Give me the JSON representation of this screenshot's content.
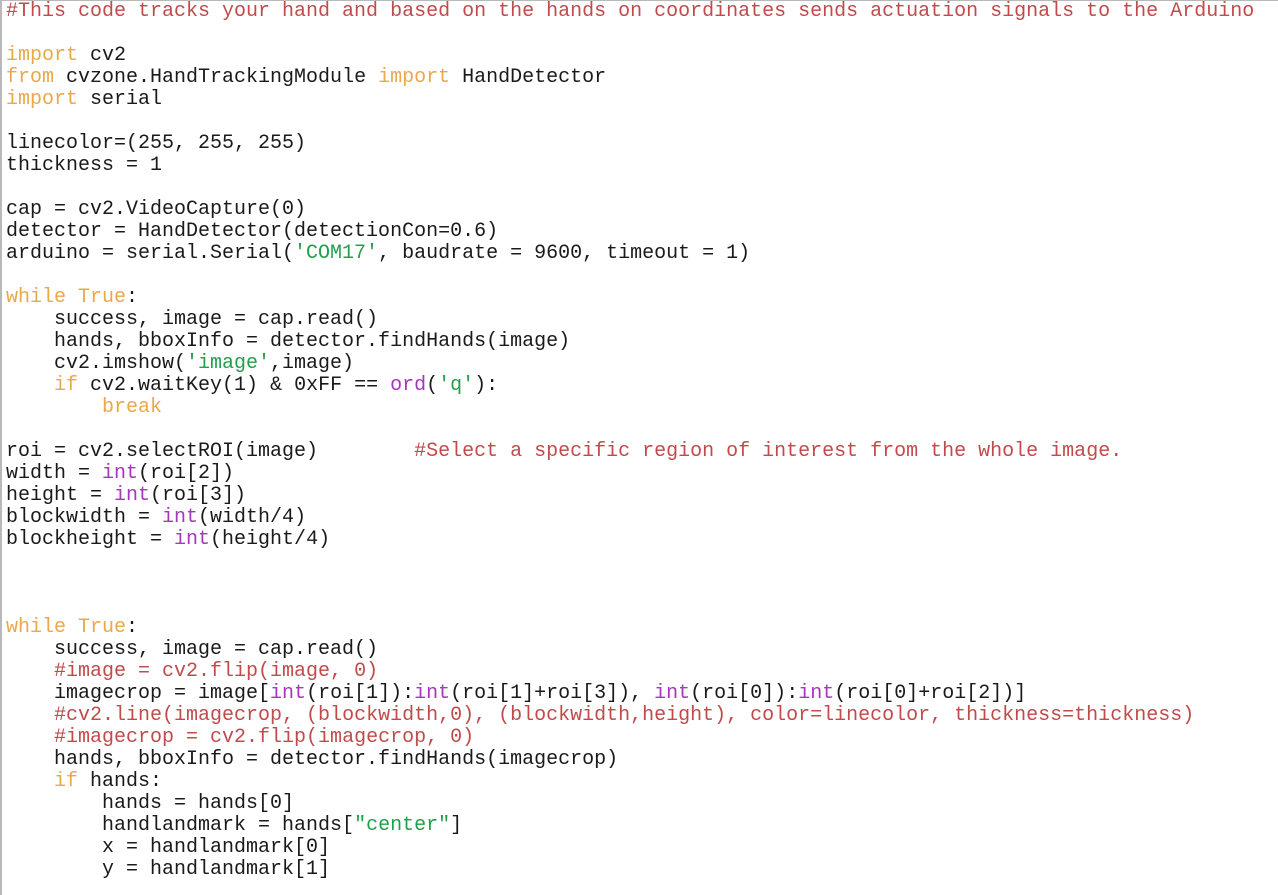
{
  "document": {
    "kind": "python-source-code",
    "language": "Python",
    "background_color": "#ffffff",
    "default_text_color": "#1a1a1a"
  },
  "syntax_colors": {
    "comment": "#c14b4b",
    "keyword": "#e9a84a",
    "string": "#21a04a",
    "builtin": "#a736bf",
    "plain": "#1a1a1a"
  },
  "code": {
    "lines": [
      [
        {
          "t": "comment",
          "s": "#This code tracks your hand and based on the hands on coordinates sends actuation signals to the Arduino"
        }
      ],
      [
        {
          "t": "plain",
          "s": ""
        }
      ],
      [
        {
          "t": "keyword",
          "s": "import"
        },
        {
          "t": "plain",
          "s": " cv2"
        }
      ],
      [
        {
          "t": "keyword",
          "s": "from"
        },
        {
          "t": "plain",
          "s": " cvzone.HandTrackingModule "
        },
        {
          "t": "keyword",
          "s": "import"
        },
        {
          "t": "plain",
          "s": " HandDetector"
        }
      ],
      [
        {
          "t": "keyword",
          "s": "import"
        },
        {
          "t": "plain",
          "s": " serial"
        }
      ],
      [
        {
          "t": "plain",
          "s": ""
        }
      ],
      [
        {
          "t": "plain",
          "s": "linecolor=(255, 255, 255)"
        }
      ],
      [
        {
          "t": "plain",
          "s": "thickness = 1"
        }
      ],
      [
        {
          "t": "plain",
          "s": ""
        }
      ],
      [
        {
          "t": "plain",
          "s": "cap = cv2.VideoCapture(0)"
        }
      ],
      [
        {
          "t": "plain",
          "s": "detector = HandDetector(detectionCon=0.6)"
        }
      ],
      [
        {
          "t": "plain",
          "s": "arduino = serial.Serial("
        },
        {
          "t": "string",
          "s": "'COM17'"
        },
        {
          "t": "plain",
          "s": ", baudrate = 9600, timeout = 1)"
        }
      ],
      [
        {
          "t": "plain",
          "s": ""
        }
      ],
      [
        {
          "t": "keyword",
          "s": "while True"
        },
        {
          "t": "plain",
          "s": ":"
        }
      ],
      [
        {
          "t": "plain",
          "s": "    success, image = cap.read()"
        }
      ],
      [
        {
          "t": "plain",
          "s": "    hands, bboxInfo = detector.findHands(image)"
        }
      ],
      [
        {
          "t": "plain",
          "s": "    cv2.imshow("
        },
        {
          "t": "string",
          "s": "'image'"
        },
        {
          "t": "plain",
          "s": ",image)"
        }
      ],
      [
        {
          "t": "plain",
          "s": "    "
        },
        {
          "t": "keyword",
          "s": "if"
        },
        {
          "t": "plain",
          "s": " cv2.waitKey(1) & 0xFF == "
        },
        {
          "t": "builtin",
          "s": "ord"
        },
        {
          "t": "plain",
          "s": "("
        },
        {
          "t": "string",
          "s": "'q'"
        },
        {
          "t": "plain",
          "s": "):"
        }
      ],
      [
        {
          "t": "plain",
          "s": "        "
        },
        {
          "t": "keyword",
          "s": "break"
        }
      ],
      [
        {
          "t": "plain",
          "s": ""
        }
      ],
      [
        {
          "t": "plain",
          "s": "roi = cv2.selectROI(image)        "
        },
        {
          "t": "comment",
          "s": "#Select a specific region of interest from the whole image."
        }
      ],
      [
        {
          "t": "plain",
          "s": "width = "
        },
        {
          "t": "builtin",
          "s": "int"
        },
        {
          "t": "plain",
          "s": "(roi[2])"
        }
      ],
      [
        {
          "t": "plain",
          "s": "height = "
        },
        {
          "t": "builtin",
          "s": "int"
        },
        {
          "t": "plain",
          "s": "(roi[3])"
        }
      ],
      [
        {
          "t": "plain",
          "s": "blockwidth = "
        },
        {
          "t": "builtin",
          "s": "int"
        },
        {
          "t": "plain",
          "s": "(width/4)"
        }
      ],
      [
        {
          "t": "plain",
          "s": "blockheight = "
        },
        {
          "t": "builtin",
          "s": "int"
        },
        {
          "t": "plain",
          "s": "(height/4)"
        }
      ],
      [
        {
          "t": "plain",
          "s": ""
        }
      ],
      [
        {
          "t": "plain",
          "s": ""
        }
      ],
      [
        {
          "t": "plain",
          "s": ""
        }
      ],
      [
        {
          "t": "keyword",
          "s": "while True"
        },
        {
          "t": "plain",
          "s": ":"
        }
      ],
      [
        {
          "t": "plain",
          "s": "    success, image = cap.read()"
        }
      ],
      [
        {
          "t": "plain",
          "s": "    "
        },
        {
          "t": "comment",
          "s": "#image = cv2.flip(image, 0)"
        }
      ],
      [
        {
          "t": "plain",
          "s": "    imagecrop = image["
        },
        {
          "t": "builtin",
          "s": "int"
        },
        {
          "t": "plain",
          "s": "(roi[1]):"
        },
        {
          "t": "builtin",
          "s": "int"
        },
        {
          "t": "plain",
          "s": "(roi[1]+roi[3]), "
        },
        {
          "t": "builtin",
          "s": "int"
        },
        {
          "t": "plain",
          "s": "(roi[0]):"
        },
        {
          "t": "builtin",
          "s": "int"
        },
        {
          "t": "plain",
          "s": "(roi[0]+roi[2])]"
        }
      ],
      [
        {
          "t": "plain",
          "s": "    "
        },
        {
          "t": "comment",
          "s": "#cv2.line(imagecrop, (blockwidth,0), (blockwidth,height), color=linecolor, thickness=thickness)"
        }
      ],
      [
        {
          "t": "plain",
          "s": "    "
        },
        {
          "t": "comment",
          "s": "#imagecrop = cv2.flip(imagecrop, 0)"
        }
      ],
      [
        {
          "t": "plain",
          "s": "    hands, bboxInfo = detector.findHands(imagecrop)"
        }
      ],
      [
        {
          "t": "plain",
          "s": "    "
        },
        {
          "t": "keyword",
          "s": "if"
        },
        {
          "t": "plain",
          "s": " hands:"
        }
      ],
      [
        {
          "t": "plain",
          "s": "        hands = hands[0]"
        }
      ],
      [
        {
          "t": "plain",
          "s": "        handlandmark = hands["
        },
        {
          "t": "string",
          "s": "\"center\""
        },
        {
          "t": "plain",
          "s": "]"
        }
      ],
      [
        {
          "t": "plain",
          "s": "        x = handlandmark[0]"
        }
      ],
      [
        {
          "t": "plain",
          "s": "        y = handlandmark[1]"
        }
      ]
    ]
  }
}
